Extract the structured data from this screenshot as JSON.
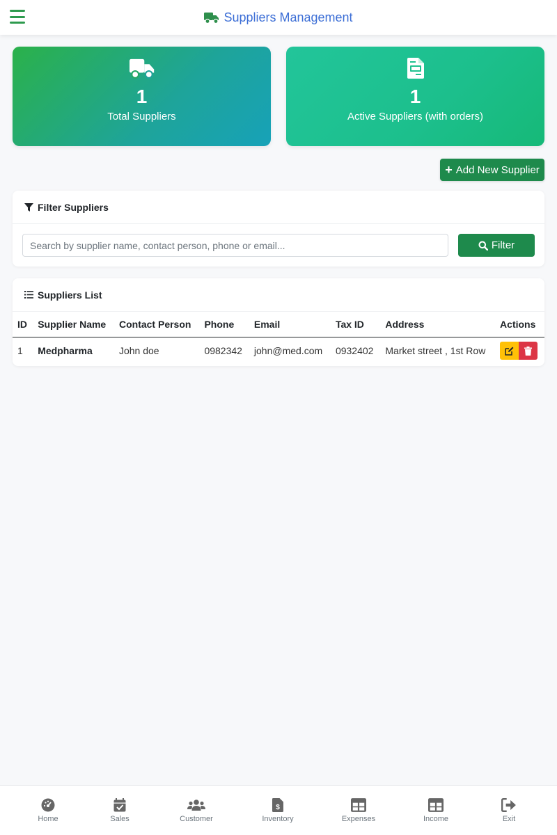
{
  "header": {
    "title": "Suppliers Management",
    "menu_icon": "hamburger-icon",
    "title_icon": "truck-icon",
    "accent_color": "#3d6fd6"
  },
  "stats": [
    {
      "icon": "truck-icon",
      "value": "1",
      "label": "Total Suppliers"
    },
    {
      "icon": "file-invoice-icon",
      "value": "1",
      "label": "Active Suppliers (with orders)"
    }
  ],
  "actions": {
    "add_label": "Add New Supplier",
    "add_icon": "plus-icon"
  },
  "filter": {
    "title": "Filter Suppliers",
    "title_icon": "funnel-icon",
    "placeholder": "Search by supplier name, contact person, phone or email...",
    "value": "",
    "button_label": "Filter",
    "button_icon": "search-icon"
  },
  "list": {
    "title": "Suppliers List",
    "title_icon": "list-icon",
    "columns": [
      "ID",
      "Supplier Name",
      "Contact Person",
      "Phone",
      "Email",
      "Tax ID",
      "Address",
      "Actions"
    ],
    "rows": [
      {
        "id": "1",
        "name": "Medpharma",
        "contact": "John doe",
        "phone": "0982342",
        "email": "john@med.com",
        "tax_id": "0932402",
        "address": "Market street , 1st Row"
      }
    ]
  },
  "nav": [
    {
      "label": "Home",
      "icon": "dashboard-gauge-icon"
    },
    {
      "label": "Sales",
      "icon": "calendar-check-icon"
    },
    {
      "label": "Customer",
      "icon": "users-icon"
    },
    {
      "label": "Inventory",
      "icon": "file-invoice-dollar-icon"
    },
    {
      "label": "Expenses",
      "icon": "table-icon"
    },
    {
      "label": "Income",
      "icon": "table-icon"
    },
    {
      "label": "Exit",
      "icon": "sign-out-icon"
    }
  ],
  "colors": {
    "primary_green": "#1e8a4c",
    "edit": "#ffc107",
    "delete": "#dc3545"
  }
}
